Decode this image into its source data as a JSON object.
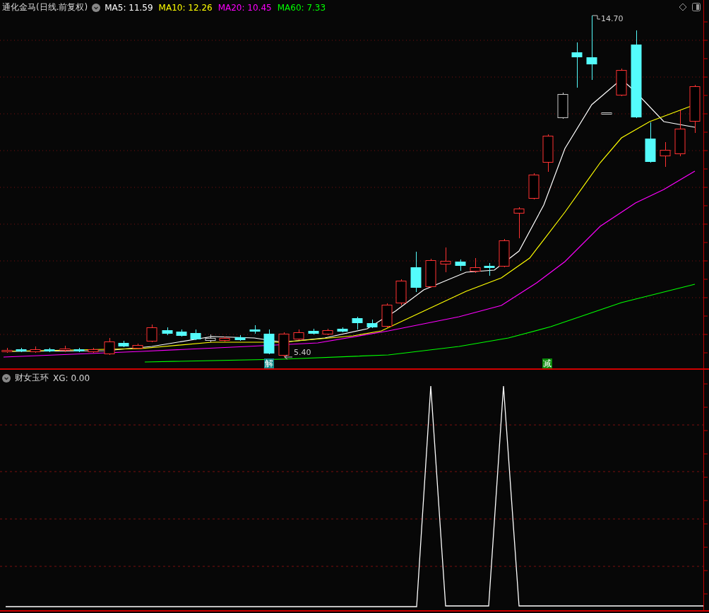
{
  "header": {
    "title": "通化金马(日线.前复权)",
    "moving_averages": [
      {
        "label": "MA5: 11.59",
        "color": "#ffffff"
      },
      {
        "label": "MA10: 12.26",
        "color": "#ffff00"
      },
      {
        "label": "MA20: 10.45",
        "color": "#ff00ff"
      },
      {
        "label": "MA60: 7.33",
        "color": "#00ff00"
      }
    ]
  },
  "price_chart": {
    "high_label": "14.70",
    "low_label": "5.40",
    "signals": [
      {
        "label": "解",
        "color": "#108a8a"
      },
      {
        "label": "减",
        "color": "#0a8a0a"
      }
    ]
  },
  "indicator": {
    "title": "财女玉环",
    "reading": "XG: 0.00"
  }
}
